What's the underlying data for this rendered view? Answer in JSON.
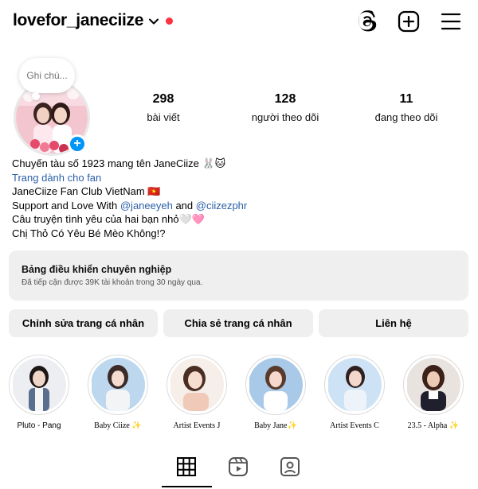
{
  "header": {
    "username": "lovefor_janeciize",
    "icons": [
      "threads-icon",
      "new-post-icon",
      "menu-icon"
    ]
  },
  "note": {
    "placeholder": "Ghi chú..."
  },
  "stats": [
    {
      "value": "298",
      "label": "bài viết"
    },
    {
      "value": "128",
      "label": "người theo dõi"
    },
    {
      "value": "11",
      "label": "đang theo dõi"
    }
  ],
  "bio": {
    "line1": "Chuyến tàu số 1923 mang tên JaneCiize 🐰🐱",
    "category": "Trang dành cho fan",
    "line3": "JaneCiize Fan Club VietNam 🇻🇳",
    "line4_prefix": "Support and Love With ",
    "mention1": "@janeeyeh",
    "line4_mid": " and ",
    "mention2": "@ciizezphr",
    "line5": "Câu truyện tình yêu của hai bạn nhỏ🤍🩷",
    "line6": "Chị Thỏ Có Yêu Bé Mèo Không!?"
  },
  "dashboard": {
    "title": "Bảng điều khiển chuyên nghiệp",
    "subtitle": "Đã tiếp cận được 39K tài khoản trong 30 ngày qua."
  },
  "actions": {
    "edit": "Chỉnh sửa trang cá nhân",
    "share": "Chia sẻ trang cá nhân",
    "contact": "Liên hệ"
  },
  "highlights": [
    {
      "label": "Pluto - Pang"
    },
    {
      "label": "Baby Ciize ✨"
    },
    {
      "label": "Artist Events J"
    },
    {
      "label": "Baby Jane✨"
    },
    {
      "label": "Artist Events C"
    },
    {
      "label": "23.5 - Alpha ✨"
    }
  ],
  "tabs": [
    "grid-icon",
    "reels-icon",
    "tagged-icon"
  ],
  "colors": {
    "accent": "#0095f6",
    "live_dot": "#ff3040",
    "mention": "#2b5fa8"
  }
}
